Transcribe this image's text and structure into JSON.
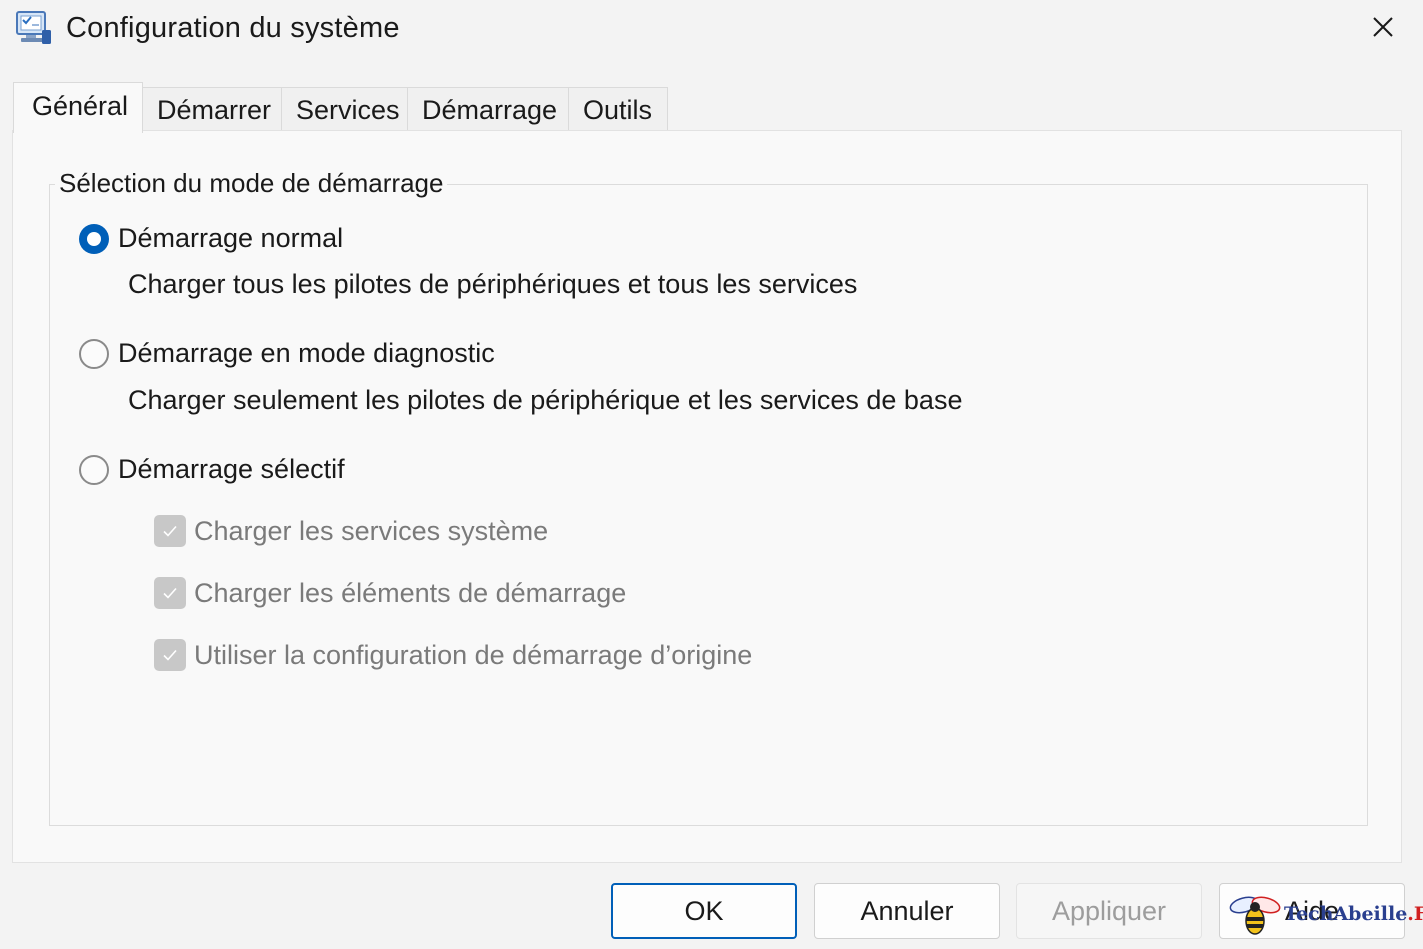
{
  "window": {
    "title": "Configuration du système",
    "app_icon": "msconfig-icon",
    "close_icon": "close-icon"
  },
  "tabs": [
    {
      "label": "Général",
      "active": true
    },
    {
      "label": "Démarrer",
      "active": false
    },
    {
      "label": "Services",
      "active": false
    },
    {
      "label": "Démarrage",
      "active": false
    },
    {
      "label": "Outils",
      "active": false
    }
  ],
  "startup_selection": {
    "legend": "Sélection du mode de démarrage",
    "options": [
      {
        "label": "Démarrage normal",
        "description": "Charger tous les pilotes de périphériques et tous les services",
        "selected": true
      },
      {
        "label": "Démarrage en mode diagnostic",
        "description": "Charger seulement les pilotes de périphérique et les services de base",
        "selected": false
      },
      {
        "label": "Démarrage sélectif",
        "selected": false
      }
    ],
    "selective_checkboxes": [
      {
        "label": "Charger les services système",
        "checked": true,
        "disabled": true
      },
      {
        "label": "Charger les éléments de démarrage",
        "checked": true,
        "disabled": true
      },
      {
        "label": "Utiliser la configuration de démarrage d’origine",
        "checked": true,
        "disabled": true
      }
    ]
  },
  "buttons": {
    "ok": "OK",
    "cancel": "Annuler",
    "apply": "Appliquer",
    "help": "Aide"
  },
  "watermark": {
    "text": "TechAbeille",
    "suffix": ".FR",
    "icon": "bee-icon"
  },
  "colors": {
    "accent": "#005fb8",
    "disabled_text": "#7a7a7a",
    "watermark_blue": "#2a3f8f",
    "watermark_red": "#d02020"
  }
}
